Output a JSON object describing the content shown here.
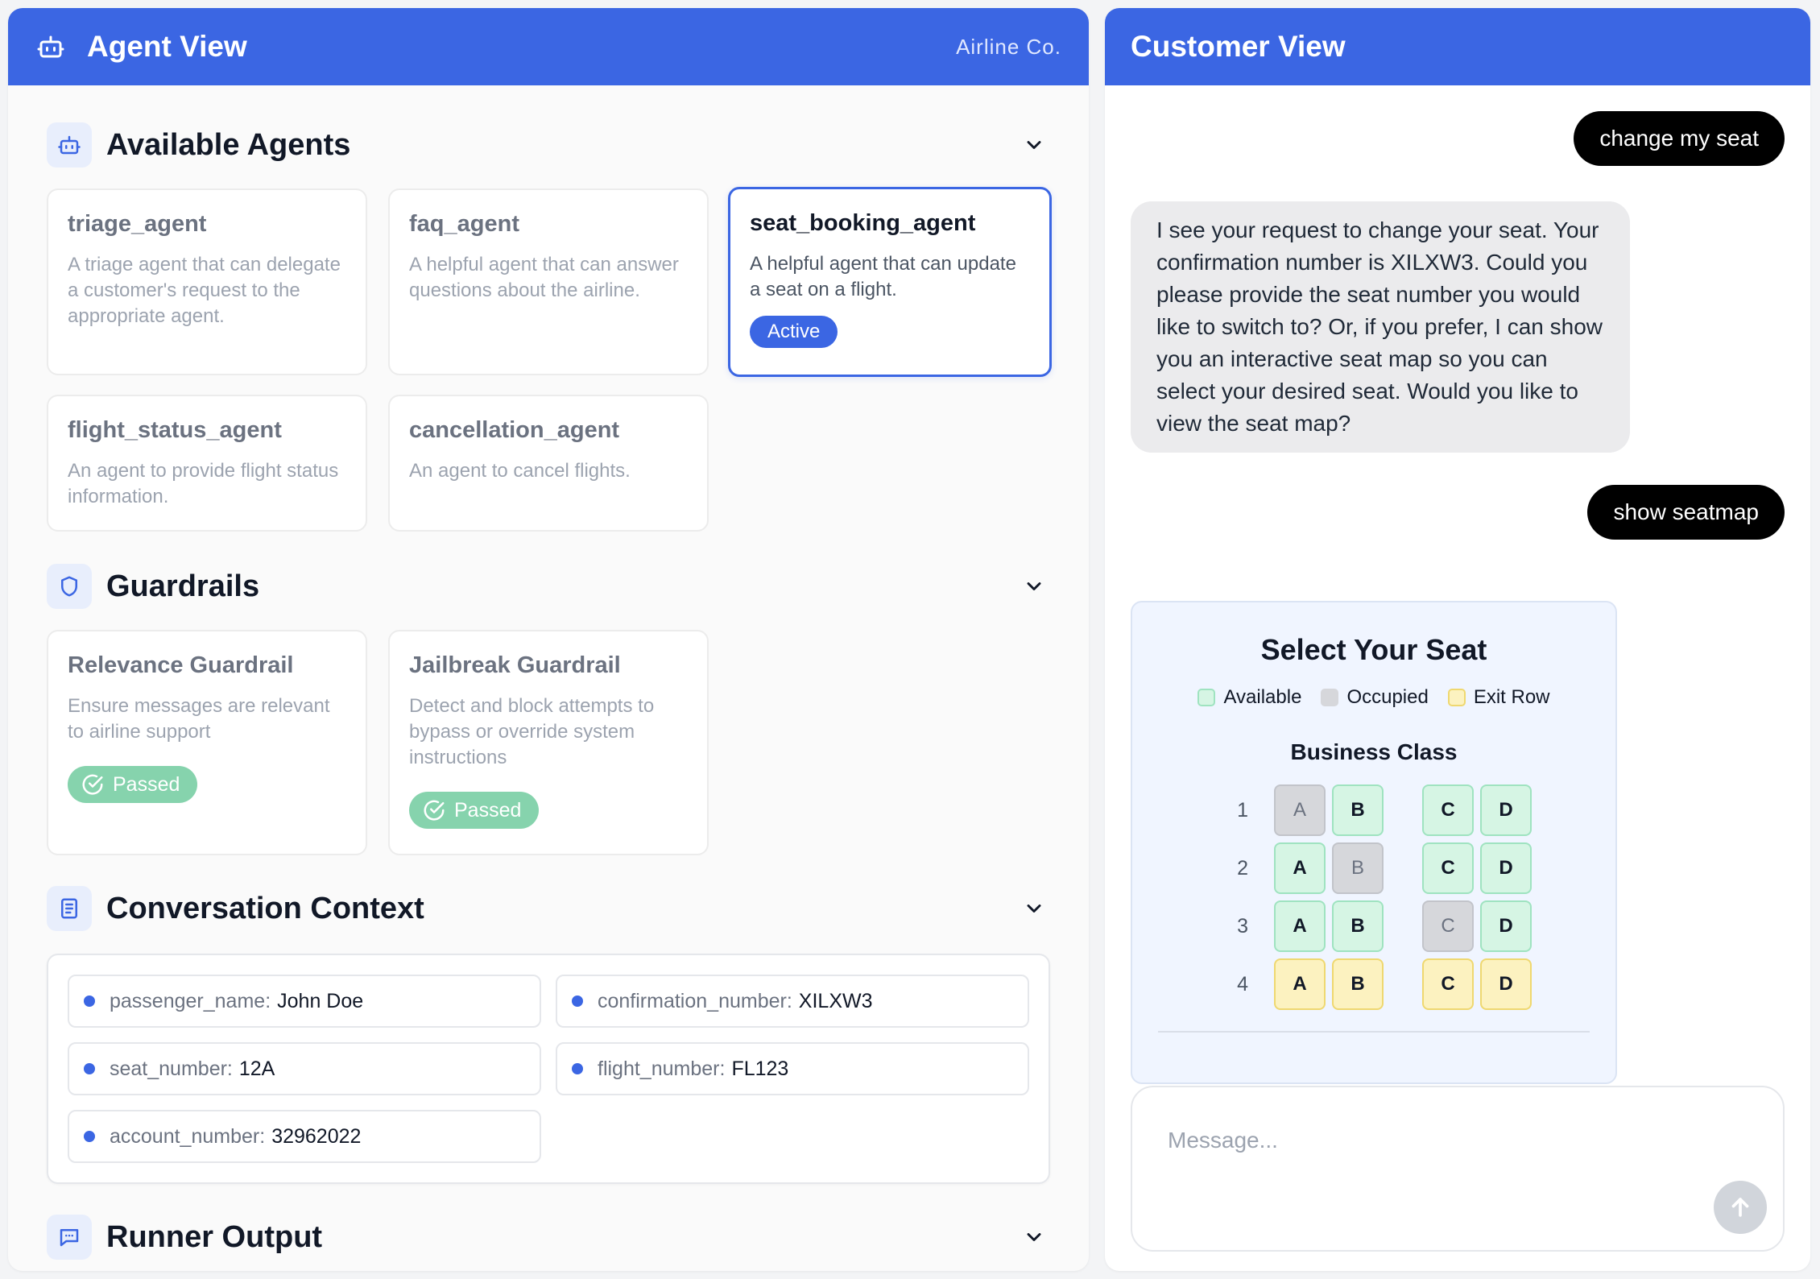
{
  "agent_panel": {
    "title": "Agent View",
    "company": "Airline Co.",
    "sections": {
      "agents": "Available Agents",
      "guardrails": "Guardrails",
      "context": "Conversation Context",
      "runner": "Runner Output"
    },
    "agents": [
      {
        "name": "triage_agent",
        "description": "A triage agent that can delegate a customer's request to the appropriate agent."
      },
      {
        "name": "faq_agent",
        "description": "A helpful agent that can answer questions about the airline."
      },
      {
        "name": "seat_booking_agent",
        "description": "A helpful agent that can update a seat on a flight.",
        "badge": "Active"
      },
      {
        "name": "flight_status_agent",
        "description": "An agent to provide flight status information."
      },
      {
        "name": "cancellation_agent",
        "description": "An agent to cancel flights."
      }
    ],
    "guardrails": [
      {
        "name": "Relevance Guardrail",
        "description": "Ensure messages are relevant to airline support",
        "status": "Passed"
      },
      {
        "name": "Jailbreak Guardrail",
        "description": "Detect and block attempts to bypass or override system instructions",
        "status": "Passed"
      }
    ],
    "context": [
      {
        "key": "passenger_name:",
        "value": "John Doe"
      },
      {
        "key": "confirmation_number:",
        "value": "XILXW3"
      },
      {
        "key": "seat_number:",
        "value": "12A"
      },
      {
        "key": "flight_number:",
        "value": "FL123"
      },
      {
        "key": "account_number:",
        "value": "32962022"
      }
    ]
  },
  "customer_panel": {
    "title": "Customer View",
    "messages": [
      {
        "role": "user",
        "text": "change my seat"
      },
      {
        "role": "assistant",
        "text": "I see your request to change your seat. Your confirmation number is XILXW3. Could you please provide the seat number you would like to switch to? Or, if you prefer, I can show you an interactive seat map so you can select your desired seat. Would you like to view the seat map?"
      },
      {
        "role": "user",
        "text": "show seatmap"
      }
    ],
    "seatmap": {
      "title": "Select Your Seat",
      "legend": [
        "Available",
        "Occupied",
        "Exit Row"
      ],
      "class_name": "Business Class",
      "rows": [
        {
          "num": "1",
          "seats": [
            {
              "l": "A",
              "s": "occupied"
            },
            {
              "l": "B",
              "s": "available"
            },
            {
              "l": "C",
              "s": "available"
            },
            {
              "l": "D",
              "s": "available"
            }
          ]
        },
        {
          "num": "2",
          "seats": [
            {
              "l": "A",
              "s": "available"
            },
            {
              "l": "B",
              "s": "occupied"
            },
            {
              "l": "C",
              "s": "available"
            },
            {
              "l": "D",
              "s": "available"
            }
          ]
        },
        {
          "num": "3",
          "seats": [
            {
              "l": "A",
              "s": "available"
            },
            {
              "l": "B",
              "s": "available"
            },
            {
              "l": "C",
              "s": "occupied"
            },
            {
              "l": "D",
              "s": "available"
            }
          ]
        },
        {
          "num": "4",
          "seats": [
            {
              "l": "A",
              "s": "exit"
            },
            {
              "l": "B",
              "s": "exit"
            },
            {
              "l": "C",
              "s": "exit"
            },
            {
              "l": "D",
              "s": "exit"
            }
          ]
        }
      ]
    },
    "input": {
      "placeholder": "Message..."
    }
  },
  "colors": {
    "accent": "#3b66e3",
    "passed": "#86d3ad",
    "available": "#d6f5e4",
    "occupied": "#d6d7db",
    "exit": "#fcf2c0"
  }
}
